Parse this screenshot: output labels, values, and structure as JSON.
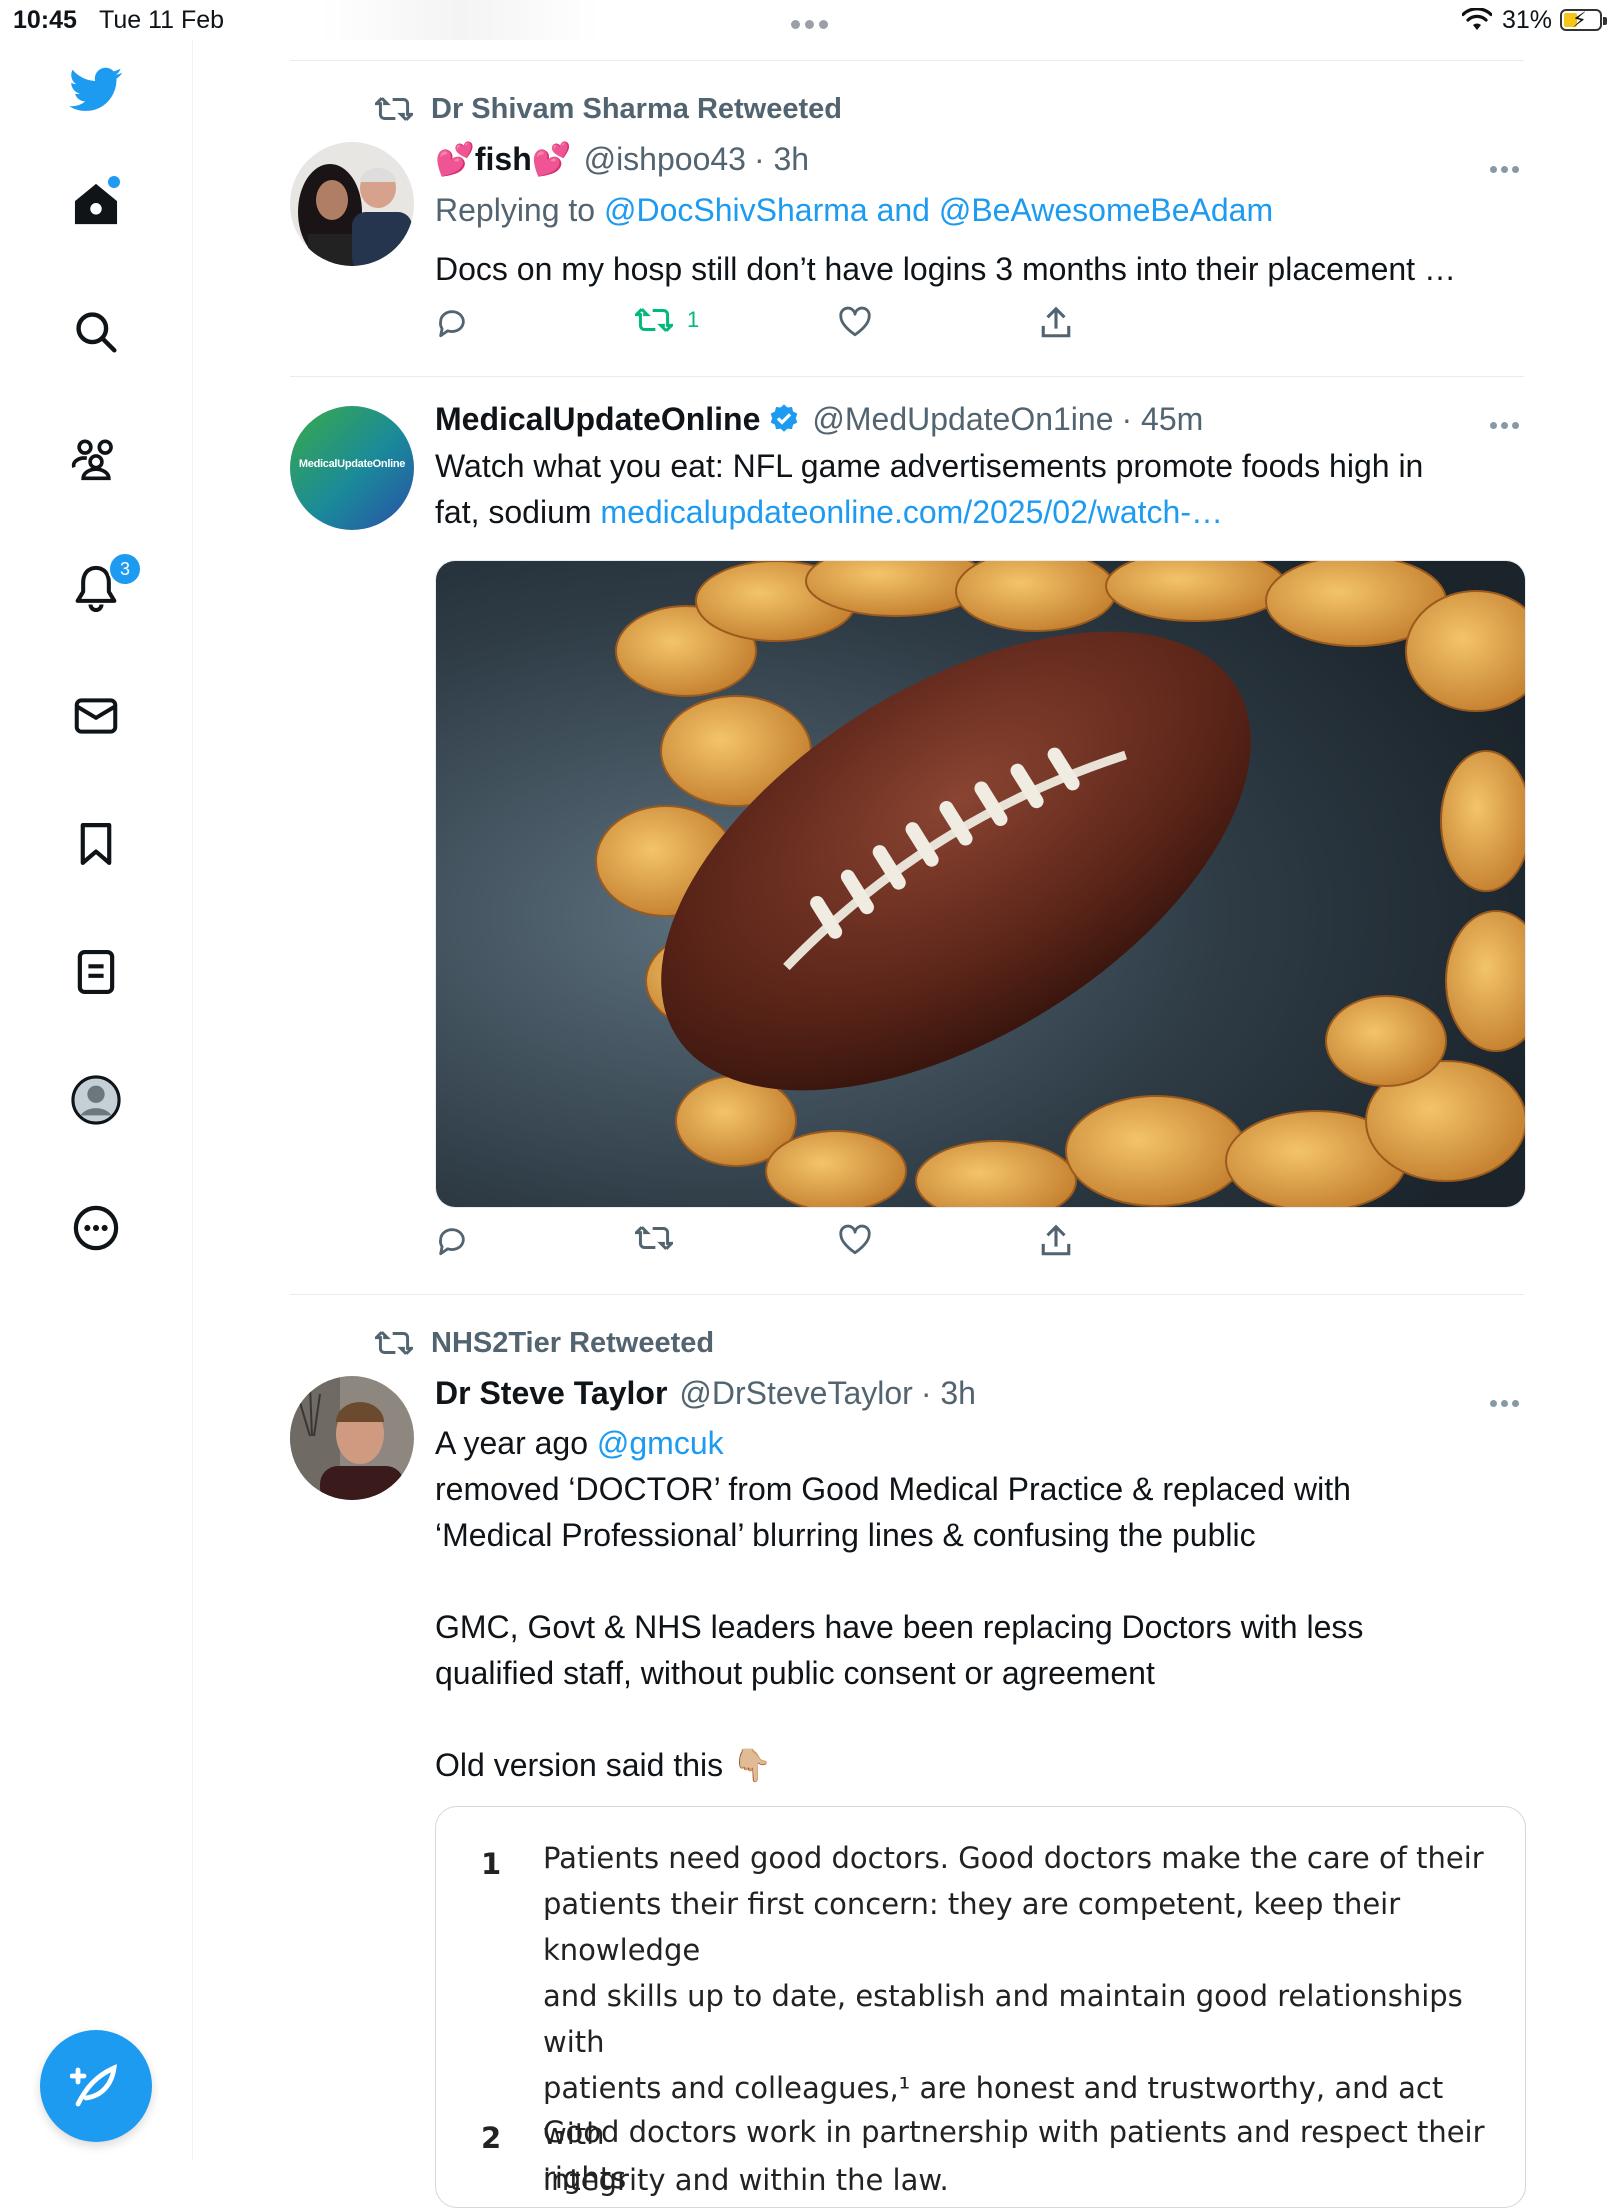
{
  "status_bar": {
    "time": "10:45",
    "date": "Tue 11 Feb",
    "battery_percent": "31%"
  },
  "sidebar": {
    "notifications_badge": "3",
    "items": [
      "twitter-logo",
      "home",
      "search",
      "communities",
      "notifications",
      "messages",
      "bookmarks",
      "lists",
      "profile",
      "more"
    ]
  },
  "tweets": [
    {
      "retweeted_by": "Dr Shivam Sharma Retweeted",
      "name_prefix_emoji": "💕",
      "name": "fish",
      "name_suffix_emoji": "💕",
      "handle": "@ishpoo43",
      "time": "· 3h",
      "replying_label": "Replying to",
      "reply_to_1": "@DocShivSharma",
      "reply_and": "and",
      "reply_to_2": "@BeAwesomeBeAdam",
      "text": "Docs on my hosp still don’t have logins 3 months into their placement …",
      "retweet_count": "1"
    },
    {
      "name": "MedicalUpdateOnline",
      "verified": true,
      "handle": "@MedUpdateOn1ine",
      "time": "· 45m",
      "avatar_text": "MedicalUpdateOnline",
      "text_line1": "Watch what you eat: NFL game advertisements promote foods high in",
      "text_line2_prefix": "fat, sodium",
      "link": "medicalupdateonline.com/2025/02/watch-…"
    },
    {
      "retweeted_by": "NHS2Tier Retweeted",
      "name": "Dr Steve Taylor",
      "handle": "@DrSteveTaylor",
      "time": "· 3h",
      "line1_prefix": "A year ago",
      "line1_mention": "@gmcuk",
      "line2": "removed ‘DOCTOR’ from Good Medical Practice & replaced with",
      "line3": "‘Medical Professional’ blurring lines & confusing the public",
      "line4": "GMC, Govt & NHS leaders have been replacing Doctors with less",
      "line5": "qualified staff, without public consent or agreement",
      "line6": "Old version said this",
      "line6_emoji": "👇🏼",
      "quote": {
        "item1_num": "1",
        "item1_l1": "Patients need good doctors. Good doctors make the care of their",
        "item1_l2": "patients their first concern: they are competent, keep their knowledge",
        "item1_l3": "and skills up to date, establish and maintain good relationships with",
        "item1_l4": "patients and colleagues,¹ are honest and trustworthy, and act with",
        "item1_l5": "integrity and within the law.",
        "item2_num": "2",
        "item2_l1": "Good doctors work in partnership with patients and respect their rights"
      }
    }
  ],
  "colors": {
    "accent": "#1d9bf0",
    "retweet_green": "#00ba7c",
    "muted": "#536471"
  }
}
